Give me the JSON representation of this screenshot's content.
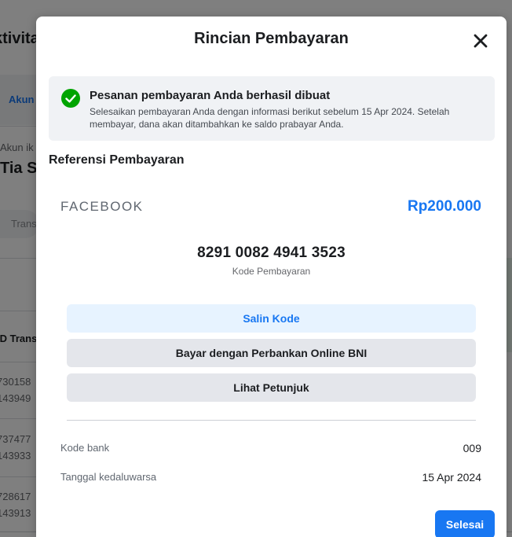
{
  "background": {
    "page_title": "ktivita",
    "tab_label": "Akun",
    "account_label": "Akun ik",
    "account_name": "Tia S",
    "search_placeholder": "Trans",
    "column_header": "ID Trans",
    "rows": [
      {
        "line1": "730158",
        "line2": "143949"
      },
      {
        "line1": "737477",
        "line2": "143933"
      },
      {
        "line1": "728617",
        "line2": "143913"
      }
    ]
  },
  "modal": {
    "title": "Rincian Pembayaran",
    "close_icon": "close-icon",
    "success": {
      "icon": "check-circle-icon",
      "title": "Pesanan pembayaran Anda berhasil dibuat",
      "description": "Selesaikan pembayaran Anda dengan informasi berikut sebelum 15 Apr 2024. Setelah membayar, dana akan ditambahkan ke saldo prabayar Anda."
    },
    "section_title": "Referensi Pembayaran",
    "merchant": "FACEBOOK",
    "amount": "Rp200.000",
    "payment_code": "8291 0082 4941 3523",
    "payment_code_label": "Kode Pembayaran",
    "buttons": {
      "copy": "Salin Kode",
      "bank": "Bayar dengan Perbankan Online BNI",
      "guide": "Lihat Petunjuk"
    },
    "details": [
      {
        "label": "Kode bank",
        "value": "009"
      },
      {
        "label": "Tanggal kedaluwarsa",
        "value": "15 Apr 2024"
      }
    ],
    "done_label": "Selesai"
  },
  "colors": {
    "accent": "#1877f2",
    "success_green": "#00a400",
    "overlay": "rgba(0,0,0,0.5)"
  }
}
